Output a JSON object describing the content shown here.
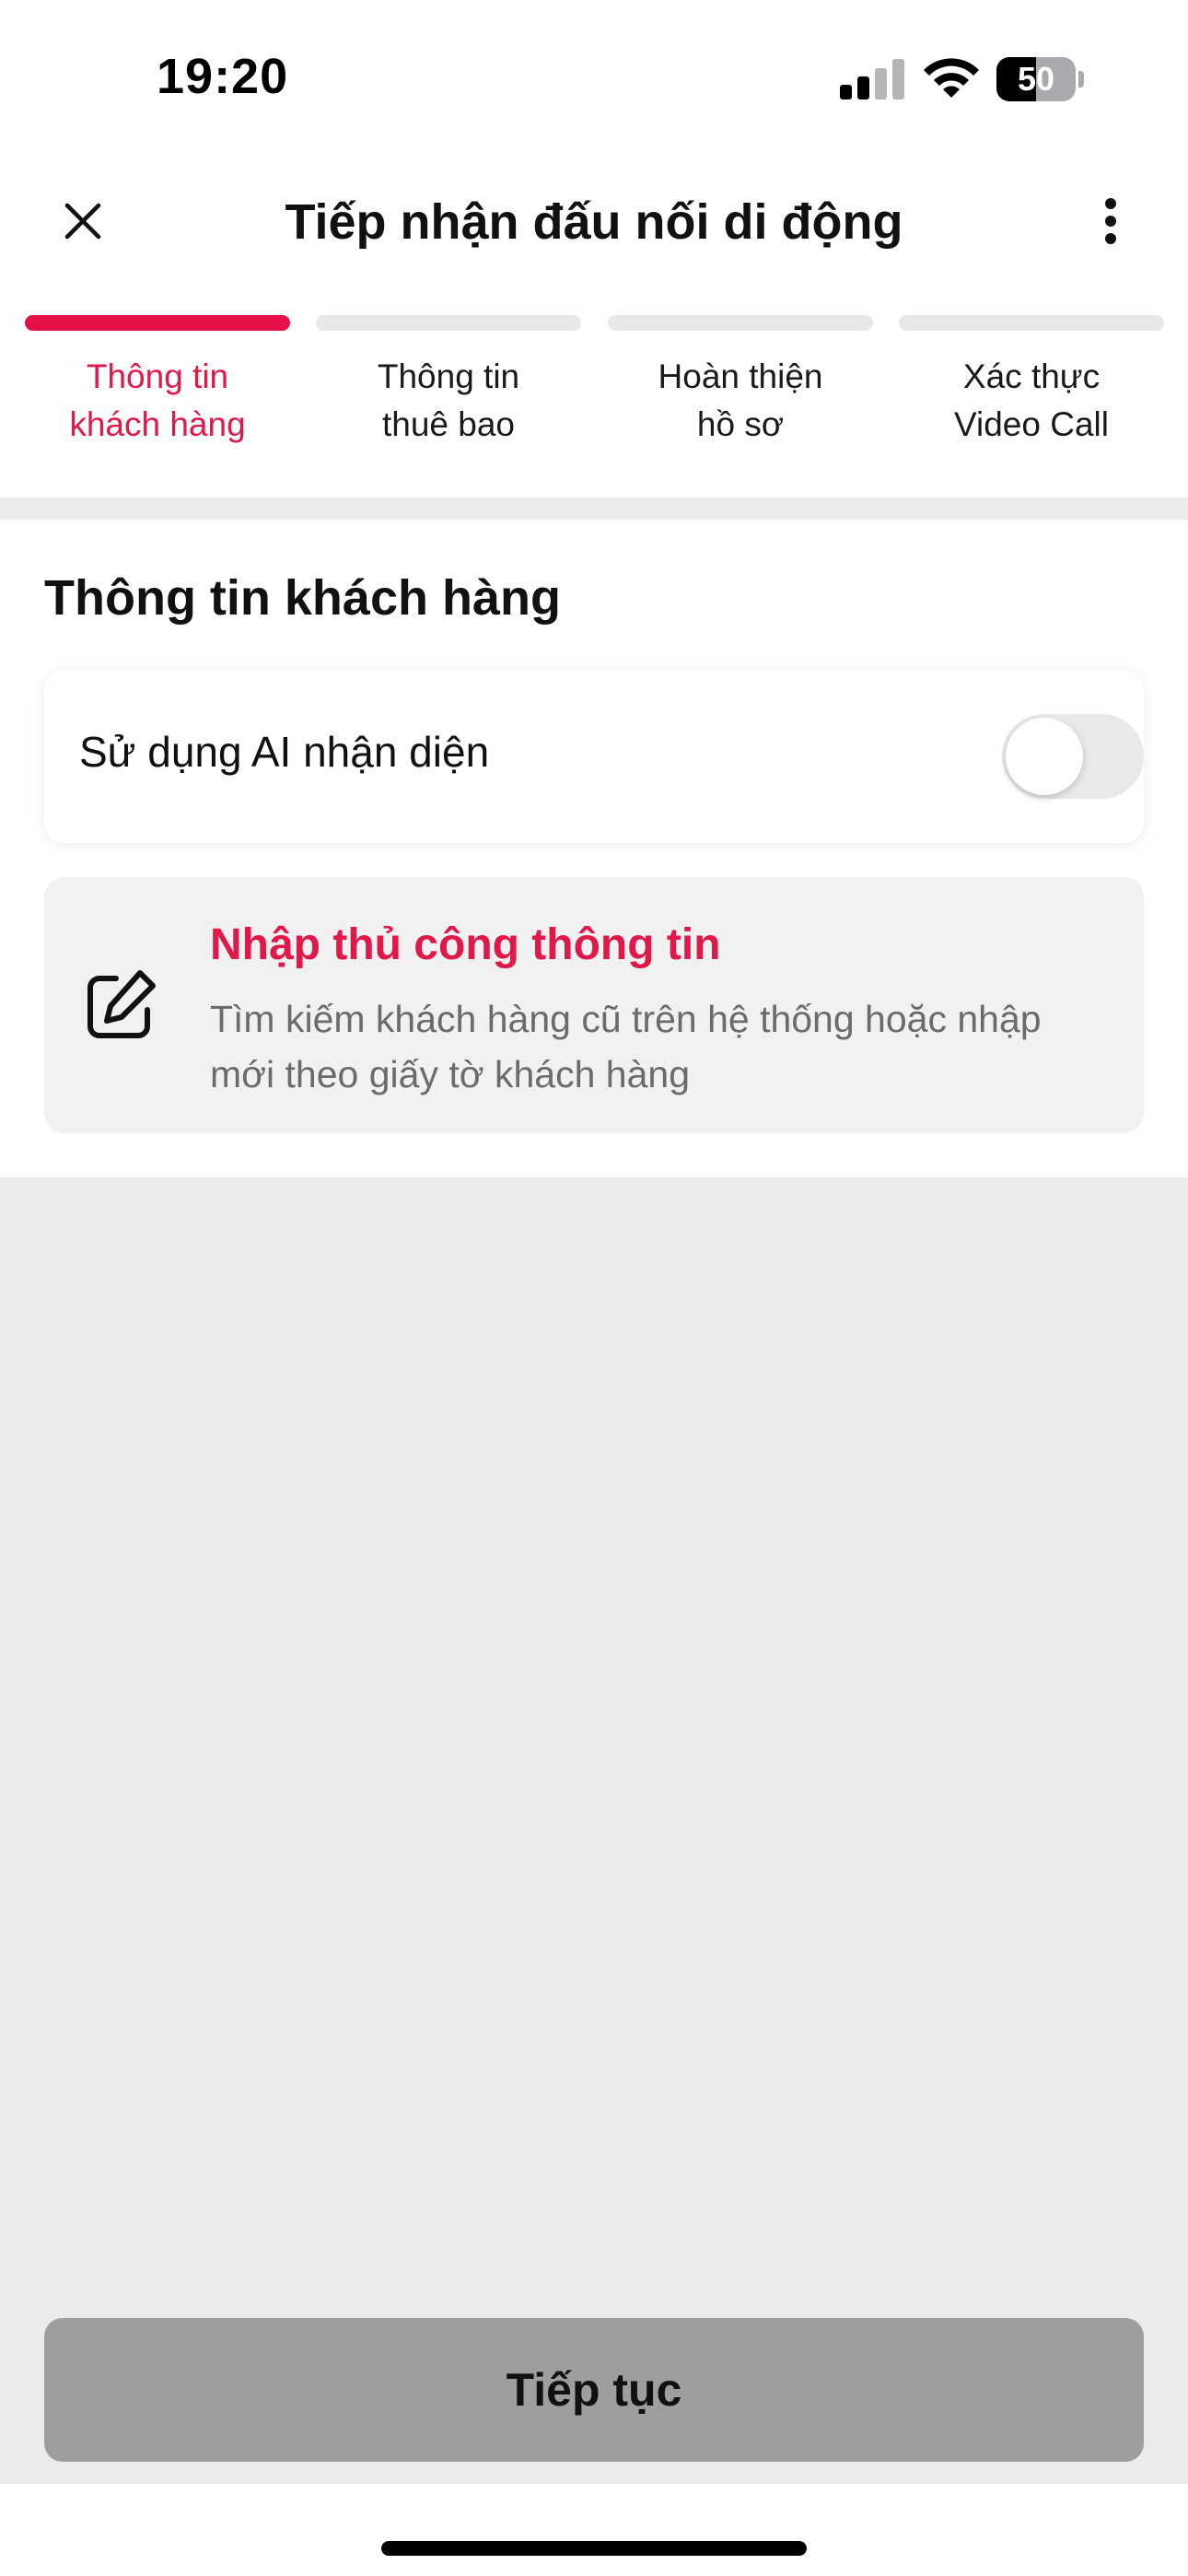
{
  "status_bar": {
    "time": "19:20",
    "battery_level": "50",
    "battery_fraction": 0.5,
    "icons": [
      "signal-icon",
      "wifi-icon",
      "battery-icon"
    ]
  },
  "header": {
    "title": "Tiếp nhận đấu nối di động",
    "left_icon": "close-icon",
    "right_icon": "more-vertical-icon"
  },
  "stepper": {
    "active_index": 0,
    "steps": [
      {
        "label": "Thông tin\nkhách hàng"
      },
      {
        "label": "Thông tin\nthuê bao"
      },
      {
        "label": "Hoàn thiện\nhồ sơ"
      },
      {
        "label": "Xác thực\nVideo Call"
      }
    ]
  },
  "section": {
    "title": "Thông tin khách hàng",
    "ai_toggle": {
      "label": "Sử dụng AI nhận diện",
      "checked": false
    },
    "manual_entry": {
      "icon": "edit-icon",
      "title": "Nhập thủ công thông tin",
      "description": "Tìm kiếm khách hàng cũ trên hệ thống hoặc nhập mới theo giấy tờ khách hàng"
    }
  },
  "footer": {
    "continue_label": "Tiếp tục"
  },
  "colors": {
    "accent": "#e60f47",
    "inactive_step": "#e8e8e8",
    "disabled_button": "#9e9e9e",
    "background_gray": "#ebebeb"
  }
}
